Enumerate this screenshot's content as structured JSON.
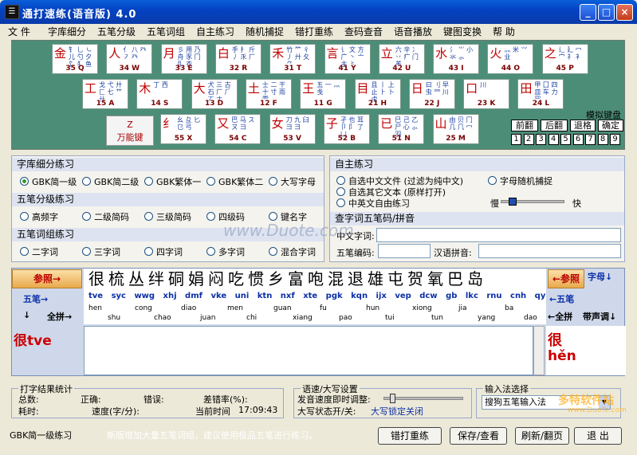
{
  "window": {
    "title": "通打速练(语音版) 4.0",
    "app_icon": "app-icon",
    "controls": [
      "_",
      "□",
      "×"
    ]
  },
  "menu": [
    "文 件",
    "字库细分",
    "五笔分级",
    "五笔词组",
    "自主练习",
    "随机捕捉",
    "错打重练",
    "查码查音",
    "语音播放",
    "键图变换",
    "帮 助"
  ],
  "keyboard": {
    "row1": [
      {
        "root": "金",
        "sub": "钅 乚 ㇃ 儿 勺 夕 饣 犭 鱼",
        "code": "35 Q"
      },
      {
        "root": "人",
        "sub": "亻 八 癶 ㇇ 癶",
        "code": "34 W"
      },
      {
        "root": "月",
        "sub": "彡 用 乃 舟 豕 冂 ⺼ 衣",
        "code": "33 E"
      },
      {
        "root": "白",
        "sub": "手 扌 斤 丿 乑 厂",
        "code": "32 R"
      },
      {
        "root": "禾",
        "sub": "竹 ⺮ 彳 丿 廾 夂 ⺈",
        "code": "31 T"
      },
      {
        "root": "言",
        "sub": "讠 文 方 广 丶 亠 主 ⺀",
        "code": "41 Y"
      },
      {
        "root": "立",
        "sub": "六 辛 冫 丷 疒 门 ⺷",
        "code": "42 U"
      },
      {
        "root": "水",
        "sub": "氵 ⺌ 小 氺 ⺗",
        "code": "43 I"
      },
      {
        "root": "火",
        "sub": "灬 米 ⺍ 业",
        "code": "44 O"
      },
      {
        "root": "之",
        "sub": "辶 廴 冖 宀 礻 衤",
        "code": "45 P"
      }
    ],
    "row2": [
      {
        "root": "工",
        "sub": "戈 弋 廾 匚 七 艹 卄",
        "code": "15 A"
      },
      {
        "root": "木",
        "sub": "丁 西",
        "code": "14 S"
      },
      {
        "root": "大",
        "sub": "犬 三 古 石 厂 ⺁ 丆 ナ",
        "code": "13 D"
      },
      {
        "root": "土",
        "sub": "士 二 干 十 寸 雨 ⻗",
        "code": "12 F"
      },
      {
        "root": "王",
        "sub": "五 一 ⺣ 戋",
        "code": "11 G"
      },
      {
        "root": "目",
        "sub": "且 丨 上 止 ⺊ 卜 虍",
        "code": "21 H"
      },
      {
        "root": "日",
        "sub": "曰 刂 早 虫 ⺜ 川",
        "code": "22 J"
      },
      {
        "root": "口",
        "sub": "川",
        "code": "23 K"
      },
      {
        "root": "田",
        "sub": "甲 囗 四 皿 车 力 罒",
        "code": "24 L"
      }
    ],
    "row3": [
      {
        "root": "纟",
        "sub": "幺 彑 匕 ⺋ 弓",
        "code": "55 X"
      },
      {
        "root": "又",
        "sub": "巴 马 ス ㄡ ⺕",
        "code": "54 C"
      },
      {
        "root": "女",
        "sub": "刀 九 臼 彐 ⺕",
        "code": "53 V"
      },
      {
        "root": "子",
        "sub": "孑 也 耳 卩 阝 了 凵",
        "code": "52 B"
      },
      {
        "root": "已",
        "sub": "巳 己 乙 尸 心 ⺗ 羽",
        "code": "51 N"
      },
      {
        "root": "山",
        "sub": "由 贝 冂 几 ⺇ 冖",
        "code": "25 M"
      }
    ],
    "z_key": {
      "letter": "Z",
      "label": "万能键"
    },
    "vk_label": "模拟键盘",
    "vk_buttons": [
      "前翻",
      "后翻",
      "退格",
      "确定"
    ],
    "num_buttons": [
      "1",
      "2",
      "3",
      "4",
      "5",
      "6",
      "7",
      "8",
      "9"
    ]
  },
  "left_panel": {
    "sec1": {
      "title": "字库细分练习",
      "opts": [
        "GBK简一级",
        "GBK简二级",
        "GBK繁体一",
        "GBK繁体二",
        "大写字母"
      ],
      "selected": 0
    },
    "sec2": {
      "title": "五笔分级练习",
      "opts": [
        "高频字",
        "二级简码",
        "三级简码",
        "四级码",
        "键名字"
      ]
    },
    "sec3": {
      "title": "五笔词组练习",
      "opts": [
        "二字词",
        "三字词",
        "四字词",
        "多字词",
        "混合字词"
      ]
    }
  },
  "right_panel": {
    "title": "自主练习",
    "opts": [
      "自选中文文件 (过滤为纯中文)",
      "字母随机捕捉",
      "自选其它文本 (原样打开)",
      "中英文自由练习"
    ],
    "slow": "慢",
    "fast": "快",
    "lookup_title": "查字词五笔码/拼音",
    "cn_label": "中文字词:",
    "wb_label": "五笔编码:",
    "py_label": "汉语拼音:"
  },
  "watermark": "www.Duote.com",
  "practice": {
    "ref_btn": "参照→",
    "ref_btn_right": "←参照",
    "chars": "很梳丛绊硐娟闷吃惯乡富咆混退雄屯贺氧巴岛",
    "wubi_label": "五笔→",
    "wubi_label_right": "←五笔",
    "codes": "tve syc wwg xhj dmf vke uni ktn nxf xte pgk kqn ijx vep dcw gb lkc rnu cnh qynm",
    "pinyin_top": [
      "hen",
      "cong",
      "diao",
      "men",
      "guan",
      "fu",
      "hun",
      "xiong",
      "jia",
      "ba"
    ],
    "pinyin_bottom": [
      "shu",
      "chao",
      "juan",
      "chi",
      "xiang",
      "pao",
      "tui",
      "tun",
      "yang",
      "dao"
    ],
    "quanpin": "全拼→",
    "quanpin_right": "←全拼",
    "zimu": "字母",
    "shengdiao": "带声调",
    "typed": "很tve",
    "current_char": "很",
    "current_pinyin": "hěn"
  },
  "stats": {
    "legend": "打字结果统计",
    "total": "总数:",
    "correct": "正确:",
    "error": "错误:",
    "error_rate": "差错率(%):",
    "time": "耗时:",
    "speed": "速度(字/分):",
    "now": "当前时间",
    "clock": "17:09:43"
  },
  "speed": {
    "legend": "语速/大写设置",
    "adjust": "发音速度即时调整:",
    "caps": "大写状态开/关:",
    "caps_val": "大写锁定关闭"
  },
  "ime": {
    "legend": "输入法选择",
    "value": "搜狗五笔输入法"
  },
  "statusbar": {
    "mode": "GBK简一级练习",
    "notice": "新版增加大量五笔词组，建议使用极品五笔进行练习。"
  },
  "buttons": [
    "错打重练",
    "保存/查看",
    "刷新/翻页",
    "退 出"
  ],
  "logo": {
    "text": "多特软件站",
    "sub": "www.DuoTe.com"
  }
}
